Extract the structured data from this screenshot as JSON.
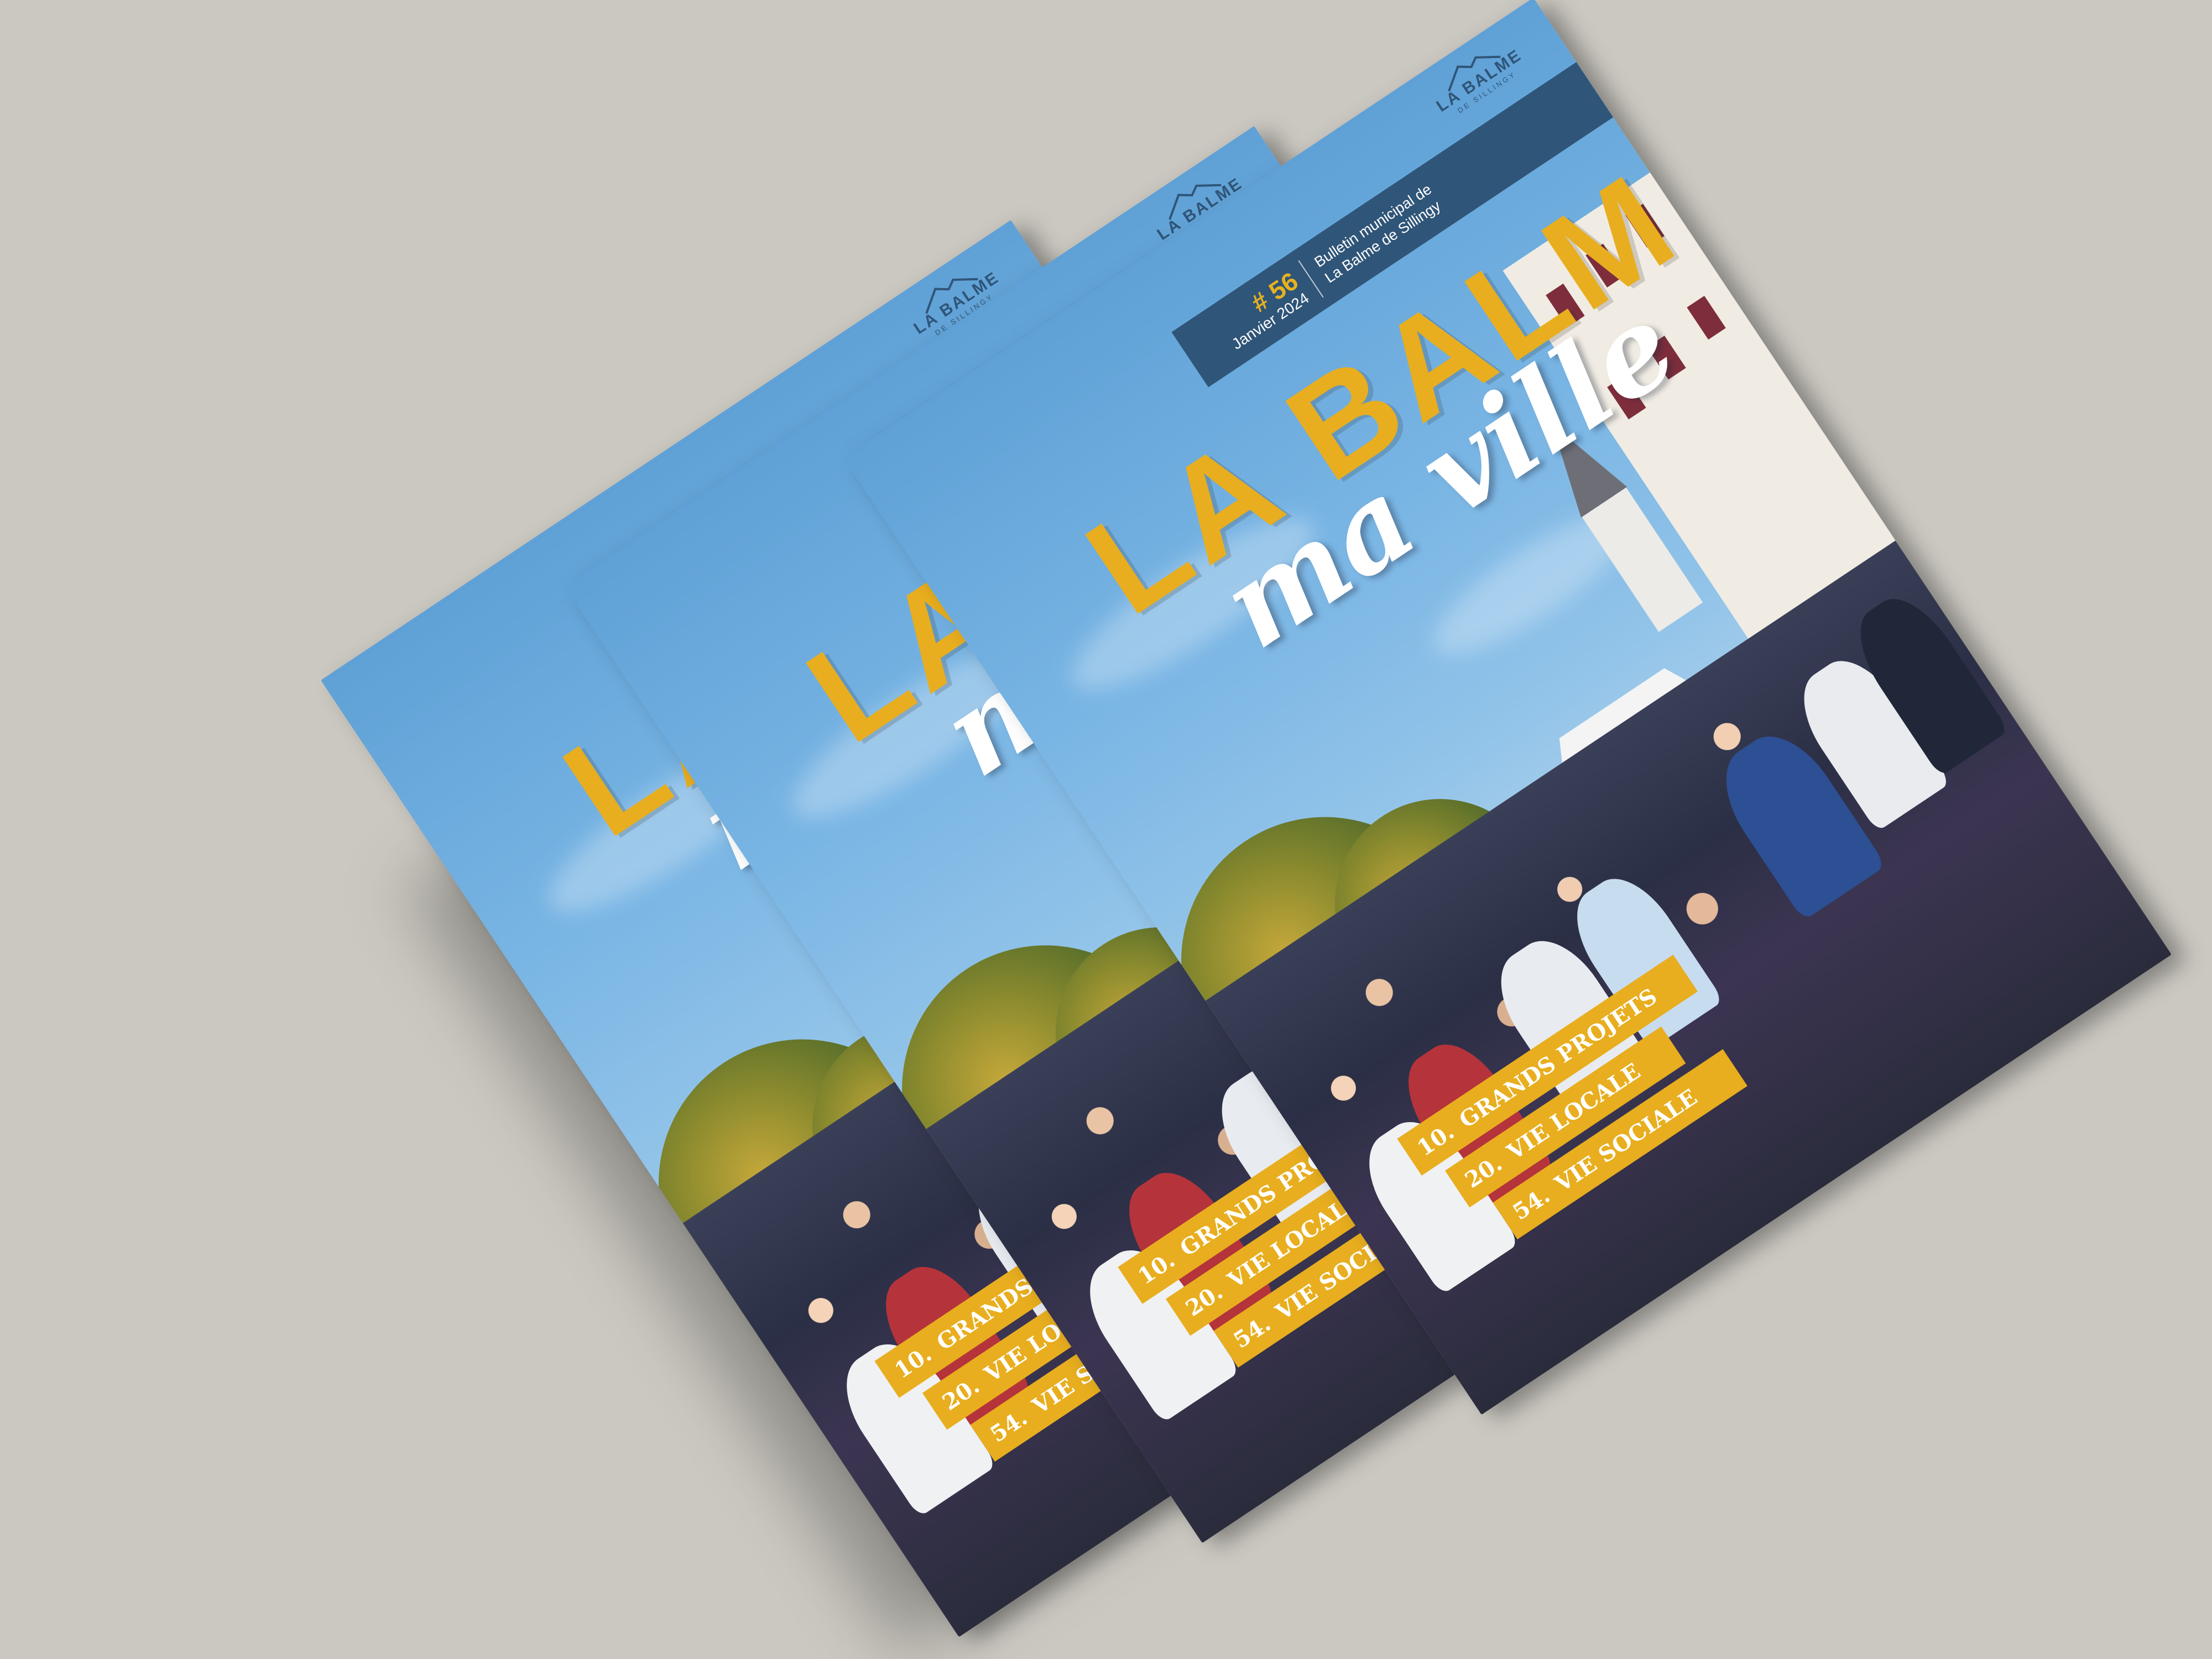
{
  "scene": {
    "background_color": "#cbc8c1",
    "description_count": 3
  },
  "cover": {
    "issue_number": "# 56",
    "issue_date": "Janvier 2024",
    "publication_line1": "Bulletin municipal de",
    "publication_line2": "La Balme de Sillingy",
    "logo_line1": "LA BALME",
    "logo_line2": "DE SILLINGY",
    "title": "LA BALME",
    "subtitle": "ma ville",
    "sections": [
      {
        "page": "10.",
        "label": "GRANDS PROJETS"
      },
      {
        "page": "20.",
        "label": "VIE LOCALE"
      },
      {
        "page": "54.",
        "label": "VIE SOCIALE"
      }
    ],
    "colors": {
      "accent_yellow": "#e8ae1f",
      "band_blue": "#2f5578",
      "sky_blue": "#79b5e4"
    }
  }
}
